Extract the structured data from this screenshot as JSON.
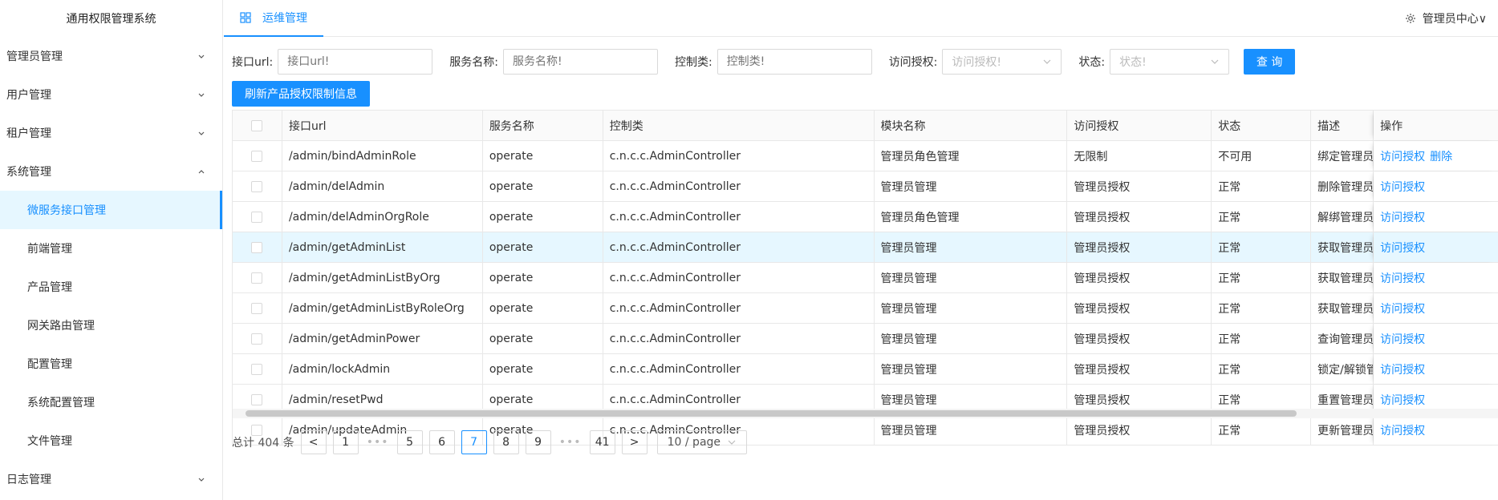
{
  "app": {
    "title": "通用权限管理系统"
  },
  "sidebar": {
    "items": [
      {
        "label": "管理员管理",
        "sub": false,
        "active": false,
        "chevron": "down"
      },
      {
        "label": "用户管理",
        "sub": false,
        "active": false,
        "chevron": "down"
      },
      {
        "label": "租户管理",
        "sub": false,
        "active": false,
        "chevron": "down"
      },
      {
        "label": "系统管理",
        "sub": false,
        "active": false,
        "chevron": "up"
      },
      {
        "label": "微服务接口管理",
        "sub": true,
        "active": true,
        "chevron": ""
      },
      {
        "label": "前端管理",
        "sub": true,
        "active": false,
        "chevron": ""
      },
      {
        "label": "产品管理",
        "sub": true,
        "active": false,
        "chevron": ""
      },
      {
        "label": "网关路由管理",
        "sub": true,
        "active": false,
        "chevron": ""
      },
      {
        "label": "配置管理",
        "sub": true,
        "active": false,
        "chevron": ""
      },
      {
        "label": "系统配置管理",
        "sub": true,
        "active": false,
        "chevron": ""
      },
      {
        "label": "文件管理",
        "sub": true,
        "active": false,
        "chevron": ""
      },
      {
        "label": "日志管理",
        "sub": false,
        "active": false,
        "chevron": "down"
      }
    ]
  },
  "header": {
    "tab_label": "运维管理",
    "admin_label": "管理员中心∨"
  },
  "filters": {
    "url_label": "接口url:",
    "url_placeholder": "接口url!",
    "service_label": "服务名称:",
    "service_placeholder": "服务名称!",
    "controller_label": "控制类:",
    "controller_placeholder": "控制类!",
    "access_label": "访问授权:",
    "access_placeholder": "访问授权!",
    "status_label": "状态:",
    "status_placeholder": "状态!",
    "query_button": "查 询"
  },
  "refresh_button": "刷新产品授权限制信息",
  "table": {
    "columns": [
      "接口url",
      "服务名称",
      "控制类",
      "模块名称",
      "访问授权",
      "状态",
      "描述",
      "操作"
    ],
    "rows": [
      {
        "url": "/admin/bindAdminRole",
        "service": "operate",
        "controller": "c.n.c.c.AdminController",
        "module": "管理员角色管理",
        "access": "无限制",
        "status": "不可用",
        "desc": "绑定管理员",
        "ops": [
          "访问授权",
          "删除"
        ]
      },
      {
        "url": "/admin/delAdmin",
        "service": "operate",
        "controller": "c.n.c.c.AdminController",
        "module": "管理员管理",
        "access": "管理员授权",
        "status": "正常",
        "desc": "删除管理员",
        "ops": [
          "访问授权"
        ]
      },
      {
        "url": "/admin/delAdminOrgRole",
        "service": "operate",
        "controller": "c.n.c.c.AdminController",
        "module": "管理员角色管理",
        "access": "管理员授权",
        "status": "正常",
        "desc": "解绑管理员",
        "ops": [
          "访问授权"
        ]
      },
      {
        "url": "/admin/getAdminList",
        "service": "operate",
        "controller": "c.n.c.c.AdminController",
        "module": "管理员管理",
        "access": "管理员授权",
        "status": "正常",
        "desc": "获取管理员",
        "ops": [
          "访问授权"
        ]
      },
      {
        "url": "/admin/getAdminListByOrg",
        "service": "operate",
        "controller": "c.n.c.c.AdminController",
        "module": "管理员管理",
        "access": "管理员授权",
        "status": "正常",
        "desc": "获取管理员",
        "ops": [
          "访问授权"
        ]
      },
      {
        "url": "/admin/getAdminListByRoleOrg",
        "service": "operate",
        "controller": "c.n.c.c.AdminController",
        "module": "管理员管理",
        "access": "管理员授权",
        "status": "正常",
        "desc": "获取管理员",
        "ops": [
          "访问授权"
        ]
      },
      {
        "url": "/admin/getAdminPower",
        "service": "operate",
        "controller": "c.n.c.c.AdminController",
        "module": "管理员管理",
        "access": "管理员授权",
        "status": "正常",
        "desc": "查询管理员",
        "ops": [
          "访问授权"
        ]
      },
      {
        "url": "/admin/lockAdmin",
        "service": "operate",
        "controller": "c.n.c.c.AdminController",
        "module": "管理员管理",
        "access": "管理员授权",
        "status": "正常",
        "desc": "锁定/解锁管",
        "ops": [
          "访问授权"
        ]
      },
      {
        "url": "/admin/resetPwd",
        "service": "operate",
        "controller": "c.n.c.c.AdminController",
        "module": "管理员管理",
        "access": "管理员授权",
        "status": "正常",
        "desc": "重置管理员",
        "ops": [
          "访问授权"
        ]
      },
      {
        "url": "/admin/updateAdmin",
        "service": "operate",
        "controller": "c.n.c.c.AdminController",
        "module": "管理员管理",
        "access": "管理员授权",
        "status": "正常",
        "desc": "更新管理员",
        "ops": [
          "访问授权"
        ]
      }
    ]
  },
  "pagination": {
    "total_label": "总计 404 条",
    "prev": "<",
    "next": ">",
    "pages": [
      "1",
      "•••",
      "5",
      "6",
      "7",
      "8",
      "9",
      "•••",
      "41"
    ],
    "current": "7",
    "page_size": "10 / page"
  },
  "colors": {
    "accent": "#1890ff",
    "highlight_row": "#e6f7ff"
  }
}
